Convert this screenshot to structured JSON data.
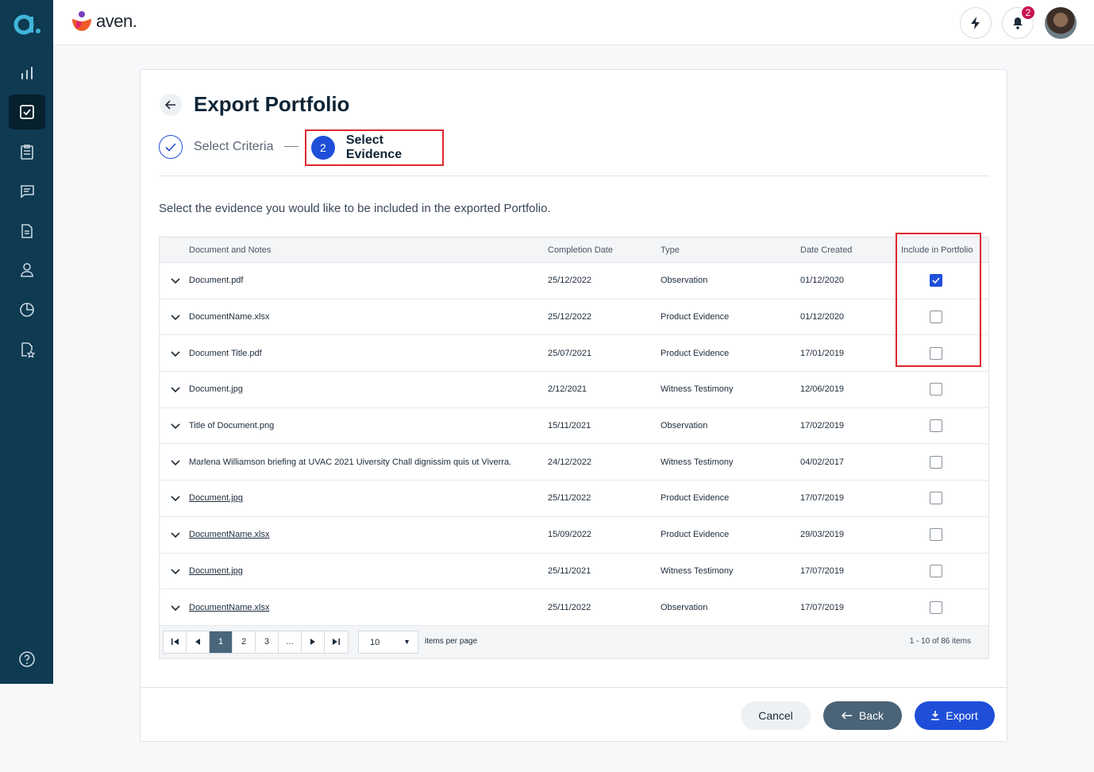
{
  "brand": {
    "name": "aven."
  },
  "notifications": {
    "count": "2"
  },
  "page": {
    "title": "Export Portfolio",
    "steps": [
      {
        "label": "Select Criteria"
      },
      {
        "number": "2",
        "label": "Select Evidence"
      }
    ],
    "intro": "Select the evidence you would like to be included in the exported Portfolio."
  },
  "table": {
    "columns": {
      "document": "Document and Notes",
      "completion": "Completion Date",
      "type": "Type",
      "created": "Date Created",
      "include": "Include in Portfolio"
    },
    "rows": [
      {
        "doc": "Document.pdf",
        "completion": "25/12/2022",
        "type": "Observation",
        "created": "01/12/2020",
        "included": true
      },
      {
        "doc": "DocumentName.xlsx",
        "completion": "25/12/2022",
        "type": "Product Evidence",
        "created": "01/12/2020",
        "included": false
      },
      {
        "doc": "Document Title.pdf",
        "completion": "25/07/2021",
        "type": "Product Evidence",
        "created": "17/01/2019",
        "included": false
      },
      {
        "doc": "Document.jpg",
        "completion": "2/12/2021",
        "type": "Witness Testimony",
        "created": "12/06/2019",
        "included": false
      },
      {
        "doc": "Title of Document.png",
        "completion": "15/11/2021",
        "type": "Observation",
        "created": "17/02/2019",
        "included": false
      },
      {
        "doc": "Marlena Williamson briefing at UVAC 2021 Uiversity Chall dignissim quis ut Viverra.",
        "completion": "24/12/2022",
        "type": "Witness Testimony",
        "created": "04/02/2017",
        "included": false
      },
      {
        "doc": "Document.jpg",
        "completion": "25/11/2022",
        "type": "Product Evidence",
        "created": "17/07/2019",
        "included": false
      },
      {
        "doc": "DocumentName.xlsx",
        "completion": "15/09/2022",
        "type": "Product Evidence",
        "created": "29/03/2019",
        "included": false
      },
      {
        "doc": "Document.jpg",
        "completion": "25/11/2021",
        "type": "Witness Testimony",
        "created": "17/07/2019",
        "included": false
      },
      {
        "doc": "DocumentName.xlsx",
        "completion": "25/11/2022",
        "type": "Observation",
        "created": "17/07/2019",
        "included": false
      }
    ]
  },
  "pager": {
    "pages": [
      "1",
      "2",
      "3",
      "..."
    ],
    "page_size": "10",
    "items_per_page": "items per page",
    "info": "1 - 10 of 86 items"
  },
  "actions": {
    "cancel": "Cancel",
    "back": "Back",
    "export": "Export"
  }
}
